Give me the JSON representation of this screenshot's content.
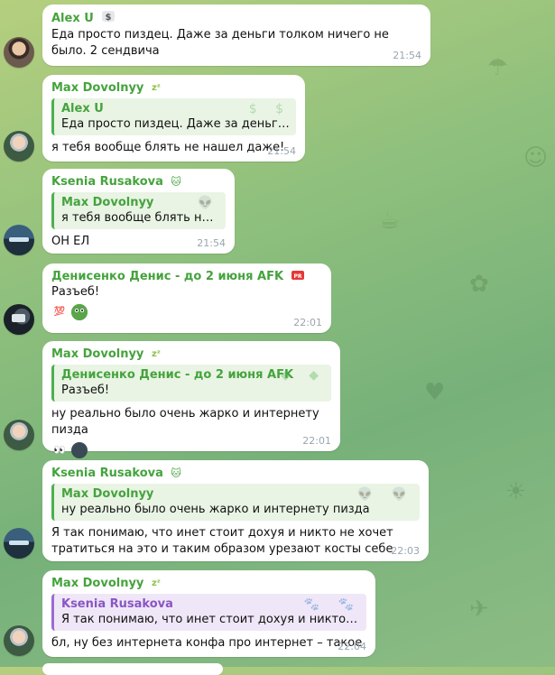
{
  "messages": [
    {
      "name": "Alex U",
      "text": "Еда просто пиздец. Даже за деньги толком ничего не было. 2 сендвича",
      "time": "21:54"
    },
    {
      "name": "Max Dovolnyy",
      "reply": {
        "name": "Alex U",
        "text": "Еда просто пиздец. Даже за деньги тол..."
      },
      "text": "я тебя вообще блять не нашел даже!",
      "time": "21:54"
    },
    {
      "name": "Ksenia Rusakova",
      "reply": {
        "name": "Max Dovolnyy",
        "text": "я тебя вообще блять не н..."
      },
      "text": "ОН ЕЛ",
      "time": "21:54"
    },
    {
      "name": "Денисенко Денис - до 2 июня AFK",
      "text": "Разъеб!",
      "time": "22:01",
      "reactions": [
        "💯",
        "🐸"
      ]
    },
    {
      "name": "Max Dovolnyy",
      "reply": {
        "name": "Денисенко Денис - до 2 июня AFK",
        "text": "Разъеб!"
      },
      "text": "ну реально было очень жарко и интернету пизда",
      "time": "22:01",
      "reactions": [
        "👀",
        "avatar"
      ]
    },
    {
      "name": "Ksenia Rusakova",
      "reply": {
        "name": "Max Dovolnyy",
        "text": "ну реально было очень жарко и интернету пизда"
      },
      "text": "Я так понимаю, что инет стоит дохуя и никто не хочет тратиться на это и таким образом урезают косты себе",
      "time": "22:03"
    },
    {
      "name": "Max Dovolnyy",
      "reply": {
        "name": "Ksenia Rusakova",
        "text": "Я так понимаю, что инет стоит дохуя и никто не хо..."
      },
      "text": "бл, ну без интернета конфа про интернет – такое",
      "time": "22:04"
    }
  ],
  "colors": {
    "name_green": "#45a33d",
    "reply_purple": "#8a55c4",
    "time_gray": "#9aa5ae"
  },
  "icons": {
    "alex_badge": "dollar-sign-icon",
    "max_badge": "sleep-zzz-icon",
    "ksenia_badge": "cat-icon",
    "denis_badge": "pro-tag-icon"
  }
}
